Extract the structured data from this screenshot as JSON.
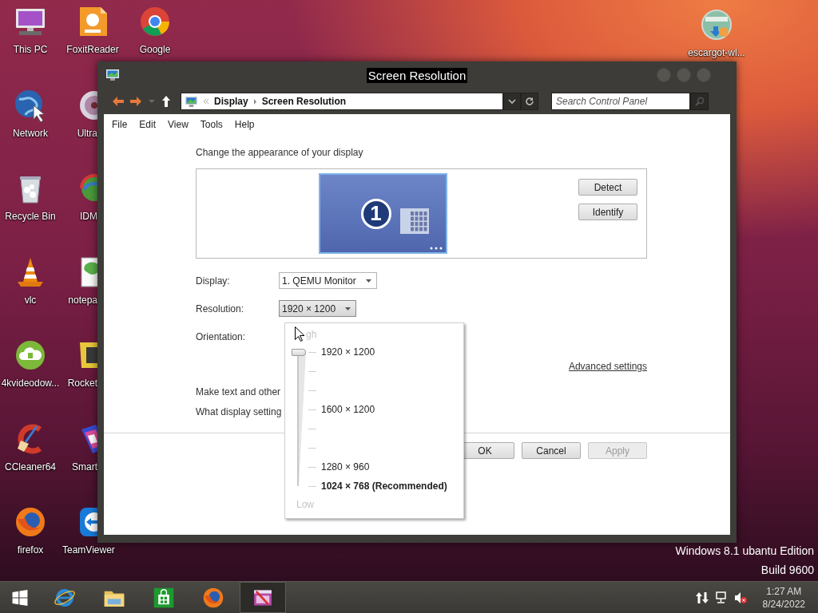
{
  "desktop": {
    "icon_columns": [
      [
        {
          "label": "This PC",
          "kind": "monitor"
        },
        {
          "label": "Network",
          "kind": "globe"
        },
        {
          "label": "Recycle Bin",
          "kind": "bin"
        },
        {
          "label": "vlc",
          "kind": "cone"
        },
        {
          "label": "4kvideodow...",
          "kind": "cloud"
        },
        {
          "label": "CCleaner64",
          "kind": "cleaner"
        },
        {
          "label": "firefox",
          "kind": "fox"
        }
      ],
      [
        {
          "label": "FoxitReader",
          "kind": "pdf"
        },
        {
          "label": "Ultra",
          "kind": "disc"
        },
        {
          "label": "IDM",
          "kind": "rainbow"
        },
        {
          "label": "notepa",
          "kind": "notepad"
        },
        {
          "label": "Rocket",
          "kind": "tile"
        },
        {
          "label": "Smart",
          "kind": "palette"
        },
        {
          "label": "TeamViewer",
          "kind": "arrows"
        }
      ],
      [
        {
          "label": "Google",
          "kind": "ring"
        }
      ]
    ],
    "corner_icon": {
      "label": "escargot-wl...",
      "kind": "badge-globe"
    },
    "watermark": [
      "Windows 8.1 ubantu Edition",
      "Build 9600"
    ]
  },
  "window": {
    "title": {
      "text": "Screen Resolution",
      "selected": true
    },
    "address": {
      "crumbs": [
        "Display",
        "Screen Resolution"
      ]
    },
    "search": {
      "placeholder": "Search Control Panel"
    },
    "menu": [
      "File",
      "Edit",
      "View",
      "Tools",
      "Help"
    ],
    "heading": "Change the appearance of your display",
    "monitor": {
      "number": "1"
    },
    "side_buttons": [
      "Detect",
      "Identify"
    ],
    "fields": [
      {
        "label": "Display:",
        "value": "1. QEMU Monitor",
        "open": false
      },
      {
        "label": "Resolution:",
        "value": "1920 × 1200",
        "open": true
      },
      {
        "label": "Orientation:"
      }
    ],
    "advanced_link": "Advanced settings",
    "links": [
      "Make text and other",
      "What display setting"
    ],
    "buttons": [
      {
        "label": "OK",
        "disabled": false
      },
      {
        "label": "Cancel",
        "disabled": false
      },
      {
        "label": "Apply",
        "disabled": true
      }
    ],
    "resolution_menu": {
      "top_label": "gh",
      "bottom_label": "Low",
      "slider": {
        "level": 1
      },
      "options": [
        {
          "label": "1920 × 1200",
          "recommended": false
        },
        {
          "label": "1600 × 1200",
          "recommended": false
        },
        {
          "label": "1280 × 960",
          "recommended": false
        },
        {
          "label": "1024 × 768 (Recommended)",
          "recommended": true
        }
      ]
    }
  },
  "taskbar": {
    "items": [
      {
        "kind": "start",
        "active": false
      },
      {
        "kind": "ie",
        "active": false
      },
      {
        "kind": "folder",
        "active": false
      },
      {
        "kind": "store",
        "active": false
      },
      {
        "kind": "fox",
        "active": false
      },
      {
        "kind": "control",
        "active": true
      }
    ],
    "clock": {
      "time": "1:27 AM",
      "date": "8/24/2022"
    }
  }
}
